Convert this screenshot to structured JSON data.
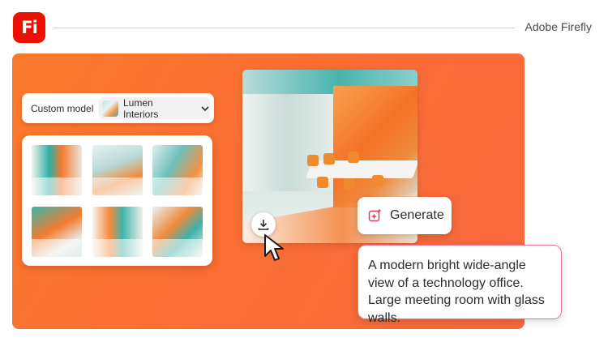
{
  "header": {
    "logo_text": "Fi",
    "brand": "Adobe Firefly"
  },
  "model_bar": {
    "label": "Custom model",
    "selected": "Lumen Interiors"
  },
  "generate": {
    "label": "Generate"
  },
  "prompt": {
    "text": "A modern bright wide-angle view of a technology office. Large meeting room with glass walls."
  },
  "colors": {
    "accent": "#eb1000",
    "stage": "#fb6e33",
    "prompt_border": "#e9739b"
  },
  "icons": [
    "firefly-logo",
    "chevron-down-icon",
    "download-icon",
    "cursor-arrow-icon",
    "sparkle-generate-icon"
  ]
}
